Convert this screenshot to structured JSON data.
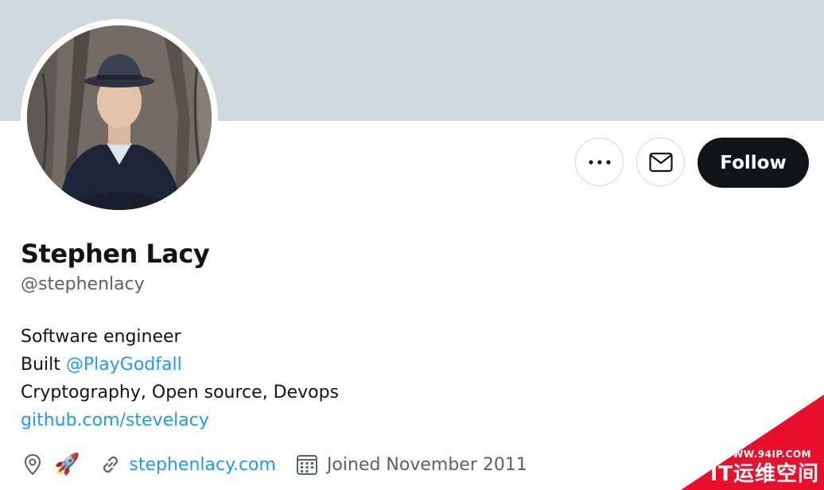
{
  "profile": {
    "name": "Stephen Lacy",
    "handle": "@stephenlacy",
    "bio": {
      "line1": "Software engineer",
      "line2_prefix": "Built ",
      "line2_mention": "@PlayGodfall",
      "line3": "Cryptography, Open source, Devops",
      "line4_link": "github.com/stevelacy"
    },
    "location_emoji": "🚀",
    "website": "stephenlacy.com",
    "joined": "Joined November 2011"
  },
  "actions": {
    "more_icon": "more-horizontal-icon",
    "message_icon": "envelope-icon",
    "follow_label": "Follow"
  },
  "colors": {
    "banner": "#cfd9de",
    "link": "#1d9bf0",
    "secondary_text": "#536471",
    "follow_bg": "#0f1419"
  },
  "watermark": {
    "url": "WWW.94IP.COM",
    "text": "IT运维空间"
  }
}
